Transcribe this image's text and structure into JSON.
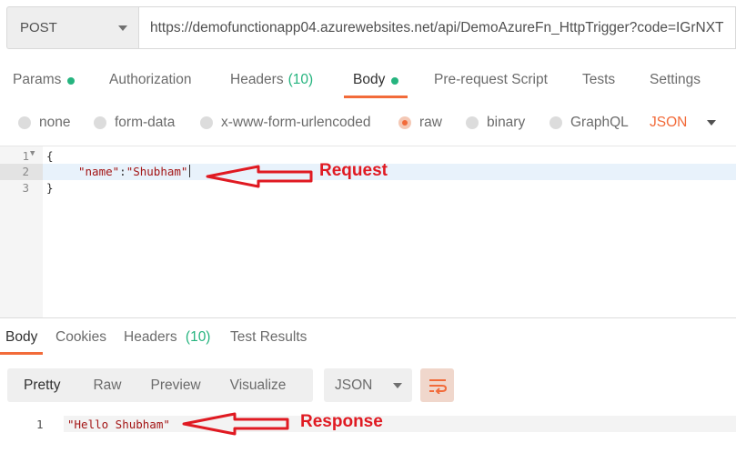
{
  "request": {
    "method": "POST",
    "url": "https://demofunctionapp04.azurewebsites.net/api/DemoAzureFn_HttpTrigger?code=IGrNXT"
  },
  "request_tabs": [
    {
      "label": "Params",
      "dot": true
    },
    {
      "label": "Authorization"
    },
    {
      "label": "Headers",
      "count": "(10)"
    },
    {
      "label": "Body",
      "dot": true,
      "active": true
    },
    {
      "label": "Pre-request Script"
    },
    {
      "label": "Tests"
    },
    {
      "label": "Settings"
    }
  ],
  "body_types": [
    {
      "label": "none"
    },
    {
      "label": "form-data"
    },
    {
      "label": "x-www-form-urlencoded"
    },
    {
      "label": "raw",
      "selected": true
    },
    {
      "label": "binary"
    },
    {
      "label": "GraphQL"
    }
  ],
  "body_format": "JSON",
  "request_editor": {
    "lines": [
      {
        "num": "1",
        "text": "{"
      },
      {
        "num": "2",
        "key": "\"name\"",
        "sep": ":",
        "value": "\"Shubham\""
      },
      {
        "num": "3",
        "text": "}"
      }
    ]
  },
  "annotations": {
    "request": "Request",
    "response": "Response",
    "color": "#e01a22"
  },
  "response_tabs": [
    {
      "label": "Body",
      "active": true
    },
    {
      "label": "Cookies"
    },
    {
      "label": "Headers",
      "count": "(10)"
    },
    {
      "label": "Test Results"
    }
  ],
  "response_view": {
    "modes": [
      "Pretty",
      "Raw",
      "Preview",
      "Visualize"
    ],
    "active_mode": "Pretty",
    "format": "JSON",
    "wrap_icon": "wrap-lines-icon"
  },
  "response_editor": {
    "lines": [
      {
        "num": "1",
        "text": "\"Hello Shubham\""
      }
    ]
  },
  "colors": {
    "accent": "#f26b3a",
    "status_dot": "#26b47f"
  }
}
